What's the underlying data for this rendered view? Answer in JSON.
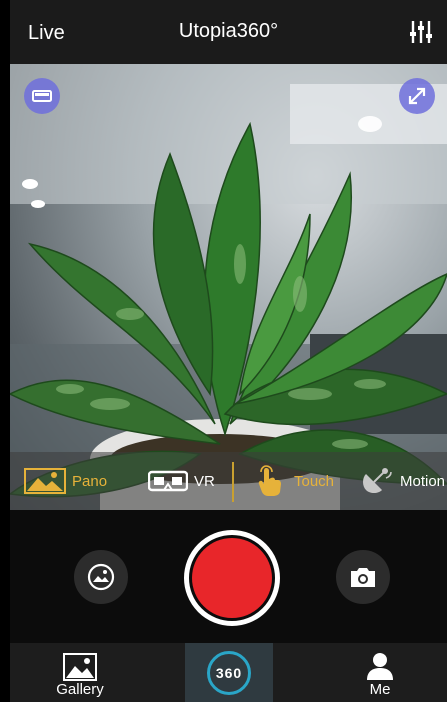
{
  "topbar": {
    "live_label": "Live",
    "title": "Utopia360°"
  },
  "modes": [
    {
      "label": "Pano",
      "icon": "landscape-icon"
    },
    {
      "label": "VR",
      "icon": "vr-goggles-icon"
    },
    {
      "label": "Touch",
      "icon": "touch-hand-icon"
    },
    {
      "label": "Motion",
      "icon": "motion-satellite-icon"
    }
  ],
  "tabs": {
    "gallery": "Gallery",
    "center": "360",
    "me": "Me"
  },
  "colors": {
    "accent": "#e6b23a",
    "record": "#e8262a",
    "badge": "#6e6edc",
    "ring": "#2aa6c8"
  }
}
